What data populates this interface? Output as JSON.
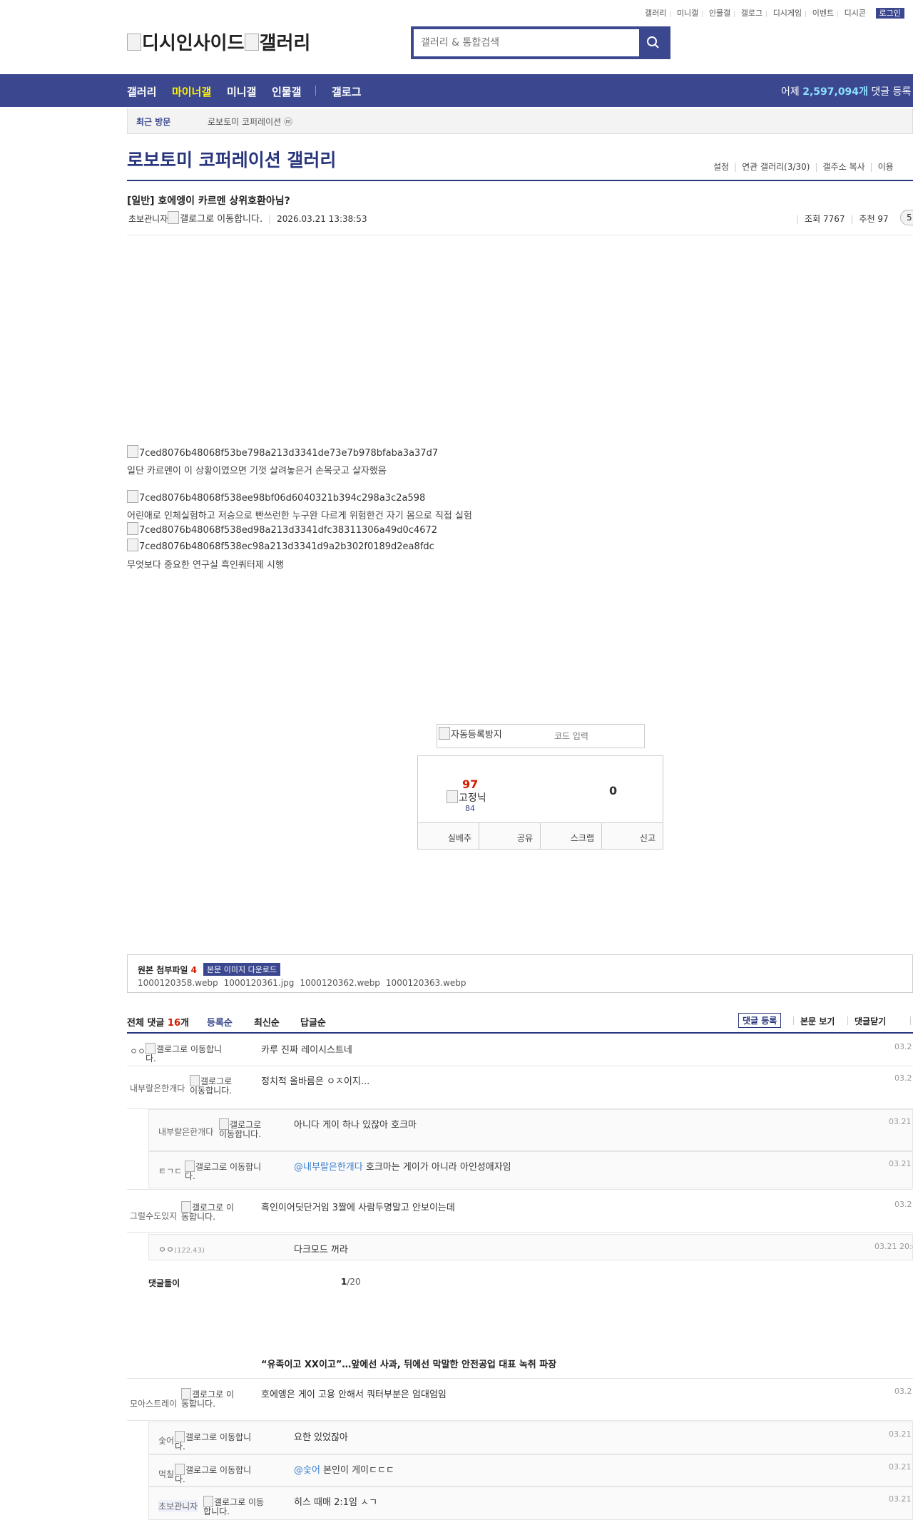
{
  "util": {
    "items": [
      "갤러리",
      "미니갤",
      "인물갤",
      "갤로그",
      "디시게임",
      "이벤트",
      "디시콘"
    ],
    "login": "로그인"
  },
  "logo": {
    "main": "디시인사이드",
    "sub": "갤러리"
  },
  "search": {
    "placeholder": "갤러리 & 통합검색"
  },
  "nav": {
    "items": [
      "갤러리",
      "마이너갤",
      "미니갤",
      "인물갤",
      "갤로그"
    ],
    "stat_prefix": "어제",
    "stat_value": "2,597,094개",
    "stat_suffix": "댓글 등록"
  },
  "recent": {
    "label": "최근 방문",
    "item": "로보토미 코퍼레이션 ⓜ"
  },
  "gallery": {
    "title": "로보토미 코퍼레이션 갤러리",
    "links": [
      "설정",
      "연관 갤러리(3/30)",
      "갤주소 복사",
      "이용"
    ]
  },
  "post": {
    "title": "[일반] 호에엥이 카르멘 상위호환아님?",
    "author": "초보관니자",
    "author_icon_alt": "갤로그로 이동합니다.",
    "date": "2026.03.21 13:38:53",
    "views_label": "조회 7767",
    "recommend_label": "추천 97",
    "comment_pill": "5"
  },
  "body": {
    "img1": "7ced8076b48068f53be798a213d3341de73e7b978bfaba3a37d7",
    "text1": "일단 카르멘이 이 상황이였으면 기껏 살려놓은거 손목긋고 살자했음",
    "img2": "7ced8076b48068f538ee98bf06d6040321b394c298a3c2a598",
    "text2": "어린애로 인체실험하고 저승으로 빤쓰런한 누구완 다르게 위험한건 자기 몸으로 직접 실험",
    "img3": "7ced8076b48068f538ed98a213d3341dfc38311306a49d0c4672",
    "img4": "7ced8076b48068f538ec98a213d3341d9a2b302f0189d2ea8fdc",
    "text3": "무엇보다 중요한 연구실 흑인쿼터제 시행"
  },
  "captcha": {
    "img_alt": "자동등록방지",
    "placeholder": "코드 입력"
  },
  "vote": {
    "up": "97",
    "fixed_label": "고정닉",
    "fixed_count": "84",
    "down": "0",
    "buttons": [
      "실베추",
      "공유",
      "스크랩",
      "신고"
    ]
  },
  "attach": {
    "label": "원본 첨부파일",
    "count": "4",
    "download": "본문 이미지 다운로드",
    "files": [
      "1000120358.webp",
      "1000120361.jpg",
      "1000120362.webp",
      "1000120363.webp"
    ]
  },
  "comments_header": {
    "total_label": "전체 댓글",
    "total_count": "16",
    "total_unit": "개",
    "sorts": [
      "등록순",
      "최신순",
      "답글순"
    ],
    "write": "댓글 등록",
    "view_body": "본문 보기",
    "close": "댓글닫기"
  },
  "gallog_alt": "갤로그로 이동합니다.",
  "comments": [
    {
      "nick": "ㅇㅇ",
      "text": "카루 진짜 레이시스트네",
      "date": "03.2"
    },
    {
      "nick": "내부랄은한개다",
      "text": "정치적 올바름은 ㅇㅈ이지...",
      "date": "03.2"
    },
    {
      "nick": "내부랄은한개다",
      "text": "아니다 게이 하나 있잖아 호크마",
      "date": "03.21 1"
    },
    {
      "nick": "ㅌㄱㄷ",
      "mention": "@내부랄은한개다",
      "text": "호크마는 게이가 아니라 아인성애자임",
      "date": "03.21 1"
    },
    {
      "nick": "그럴수도있지",
      "text": "흑인이어딧단거임 3짤에 사람두명말고 안보이는데",
      "date": "03.2"
    },
    {
      "nick": "ㅇㅇ",
      "ip": "(122.43)",
      "text": "다크모드 꺼라",
      "date": "03.21 20:4"
    },
    {
      "nick": "모아스트레이",
      "text": "호에엥은 게이 고용 안해서 쿼터부분은 엄대엄임",
      "date": "03.2"
    },
    {
      "nick": "숯어",
      "text": "요한 있었잖아",
      "date": "03.21 1"
    },
    {
      "nick": "먹칠",
      "mention": "@숯어",
      "text": "본인이 게이ㄷㄷㄷ",
      "date": "03.21 1"
    },
    {
      "nick": "초보관니자",
      "text": "히스 때매 2:1임 ㅅㄱ",
      "date": "03.21 1"
    }
  ],
  "pager": {
    "label": "댓글돌이",
    "current": "1",
    "total": "/20"
  },
  "ad": {
    "title": "“유족이고 XX이고”…앞에선 사과, 뒤에선 막말한 안전공업 대표 녹취 파장"
  }
}
